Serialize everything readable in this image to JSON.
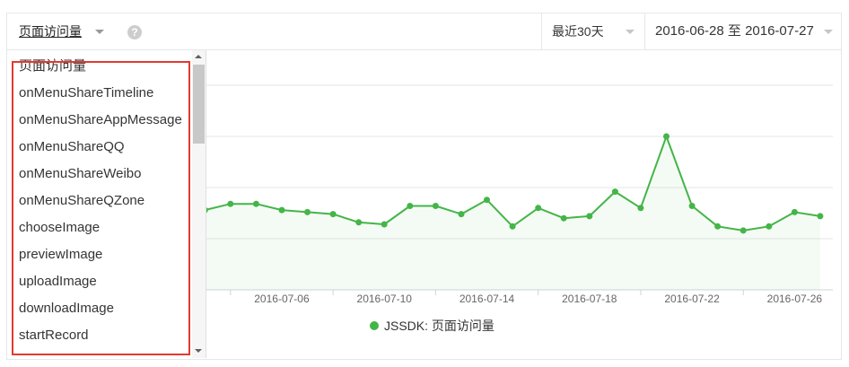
{
  "toolbar": {
    "metric": "页面访问量",
    "period": "最近30天",
    "date_range": "2016-06-28 至 2016-07-27"
  },
  "dropdown": {
    "options": [
      "页面访问量",
      "onMenuShareTimeline",
      "onMenuShareAppMessage",
      "onMenuShareQQ",
      "onMenuShareWeibo",
      "onMenuShareQZone",
      "chooseImage",
      "previewImage",
      "uploadImage",
      "downloadImage",
      "startRecord"
    ]
  },
  "icons": {
    "metric_caret": "chevron-down-icon",
    "help": "question-circle-icon",
    "period_caret": "chevron-down-icon",
    "date_caret": "chevron-down-icon",
    "scroll_up": "scroll-up-arrow-icon",
    "scroll_down": "scroll-down-arrow-icon"
  },
  "colors": {
    "accent": "#44b549",
    "highlight_box": "#e23a2f"
  },
  "chart_data": {
    "type": "line",
    "x": [
      "2016-07-03",
      "2016-07-04",
      "2016-07-05",
      "2016-07-06",
      "2016-07-07",
      "2016-07-08",
      "2016-07-09",
      "2016-07-10",
      "2016-07-11",
      "2016-07-12",
      "2016-07-13",
      "2016-07-14",
      "2016-07-15",
      "2016-07-16",
      "2016-07-17",
      "2016-07-18",
      "2016-07-19",
      "2016-07-20",
      "2016-07-21",
      "2016-07-22",
      "2016-07-23",
      "2016-07-24",
      "2016-07-25",
      "2016-07-26",
      "2016-07-27"
    ],
    "xlim": [
      "2016-06-28",
      "2016-07-27"
    ],
    "x_tick_labels": [
      "2016-07-06",
      "2016-07-10",
      "2016-07-14",
      "2016-07-18",
      "2016-07-22",
      "2016-07-26"
    ],
    "ylim": [
      0,
      1
    ],
    "grid": true,
    "legend": "bottom-center",
    "series": [
      {
        "name": "JSSDK: 页面访问量",
        "color": "#44b549",
        "values": [
          0.39,
          0.42,
          0.42,
          0.39,
          0.38,
          0.37,
          0.33,
          0.32,
          0.41,
          0.41,
          0.37,
          0.44,
          0.31,
          0.4,
          0.35,
          0.36,
          0.48,
          0.4,
          0.75,
          0.41,
          0.31,
          0.29,
          0.31,
          0.38,
          0.36
        ]
      }
    ]
  }
}
